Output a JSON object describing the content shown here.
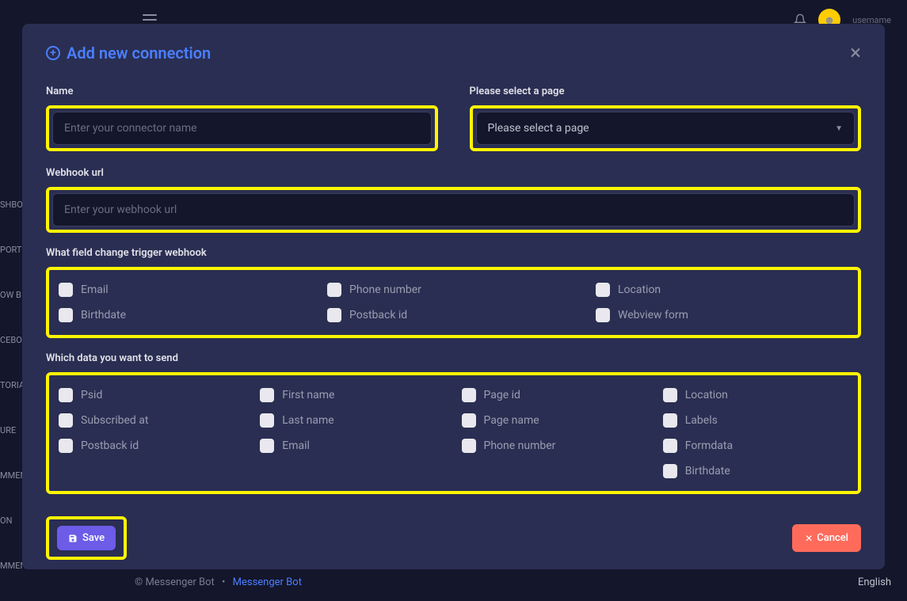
{
  "header": {
    "username": "username"
  },
  "sidebar": {
    "items": [
      "SHBO",
      "PORT",
      "OW B",
      "CEBO",
      "TORIA",
      "URE",
      "MMEN",
      "ON",
      "MMENT"
    ]
  },
  "modal": {
    "title": "Add new connection",
    "fields": {
      "name_label": "Name",
      "name_placeholder": "Enter your connector name",
      "page_label": "Please select a page",
      "page_placeholder": "Please select a page",
      "webhook_label": "Webhook url",
      "webhook_placeholder": "Enter your webhook url"
    },
    "trigger_label": "What field change trigger webhook",
    "triggers": [
      "Email",
      "Phone number",
      "Location",
      "Birthdate",
      "Postback id",
      "Webview form"
    ],
    "send_label": "Which data you want to send",
    "send_data": {
      "col1": [
        "Psid",
        "Subscribed at",
        "Postback id"
      ],
      "col2": [
        "First name",
        "Last name",
        "Email"
      ],
      "col3": [
        "Page id",
        "Page name",
        "Phone number"
      ],
      "col4": [
        "Location",
        "Labels",
        "Formdata",
        "Birthdate"
      ]
    },
    "save_label": "Save",
    "cancel_label": "Cancel"
  },
  "footer": {
    "copyright": "© Messenger Bot",
    "bullet": "•",
    "link": "Messenger Bot",
    "lang": "English"
  }
}
